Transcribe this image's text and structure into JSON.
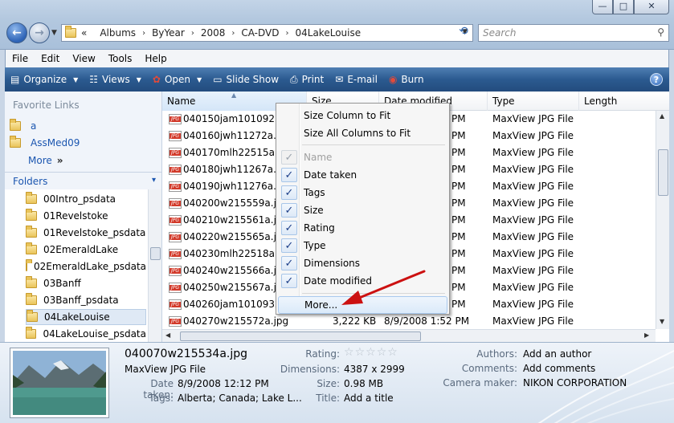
{
  "window": {
    "buttons": [
      "—",
      "□",
      "✕"
    ]
  },
  "address": {
    "overflow": "«",
    "crumbs": [
      "Albums",
      "ByYear",
      "2008",
      "CA-DVD",
      "04LakeLouise"
    ]
  },
  "search": {
    "placeholder": "Search"
  },
  "menubar": [
    "File",
    "Edit",
    "View",
    "Tools",
    "Help"
  ],
  "toolbar": {
    "organize": "Organize",
    "views": "Views",
    "open": "Open",
    "slideshow": "Slide Show",
    "print": "Print",
    "email": "E-mail",
    "burn": "Burn",
    "help": "?"
  },
  "nav": {
    "favorites_title": "Favorite Links",
    "favorites": [
      "a",
      "AssMed09"
    ],
    "more": "More",
    "more_glyph": "»",
    "folders_title": "Folders",
    "tree": [
      "00Intro_psdata",
      "01Revelstoke",
      "01Revelstoke_psdata",
      "02EmeraldLake",
      "02EmeraldLake_psdata",
      "03Banff",
      "03Banff_psdata",
      "04LakeLouise",
      "04LakeLouise_psdata"
    ],
    "selected_index": 7
  },
  "columns": {
    "name": "Name",
    "size": "Size",
    "date": "Date modified",
    "type": "Type",
    "length": "Length"
  },
  "files": [
    {
      "name": "040150jam1010925a",
      "time": "PM",
      "type": "MaxView JPG File"
    },
    {
      "name": "040160jwh11272a.jp",
      "time": "PM",
      "type": "MaxView JPG File"
    },
    {
      "name": "040170mlh22515a.jp",
      "time": "PM",
      "type": "MaxView JPG File"
    },
    {
      "name": "040180jwh11267a.jp",
      "time": "PM",
      "type": "MaxView JPG File"
    },
    {
      "name": "040190jwh11276a.jp",
      "time": "PM",
      "type": "MaxView JPG File"
    },
    {
      "name": "040200w215559a.jp",
      "time": "PM",
      "type": "MaxView JPG File"
    },
    {
      "name": "040210w215561a.jp",
      "time": "PM",
      "type": "MaxView JPG File"
    },
    {
      "name": "040220w215565a.jp",
      "time": "PM",
      "type": "MaxView JPG File"
    },
    {
      "name": "040230mlh22518a.jp",
      "time": "PM",
      "type": "MaxView JPG File"
    },
    {
      "name": "040240w215566a.jp",
      "time": "PM",
      "type": "MaxView JPG File"
    },
    {
      "name": "040250w215567a.jp",
      "time": "PM",
      "type": "MaxView JPG File"
    },
    {
      "name": "040260jam1010932a",
      "time": "PM",
      "type": "MaxView JPG File"
    },
    {
      "name": "040270w215572a.jpg",
      "size": "3,222 KB",
      "date": "8/9/2008 1:52 PM",
      "type": "MaxView JPG File"
    }
  ],
  "context_menu": {
    "size_col": "Size Column to Fit",
    "size_all": "Size All Columns to Fit",
    "items": [
      {
        "label": "Name",
        "checked": true,
        "disabled": true
      },
      {
        "label": "Date taken",
        "checked": true
      },
      {
        "label": "Tags",
        "checked": true
      },
      {
        "label": "Size",
        "checked": true
      },
      {
        "label": "Rating",
        "checked": true
      },
      {
        "label": "Type",
        "checked": true
      },
      {
        "label": "Dimensions",
        "checked": true
      },
      {
        "label": "Date modified",
        "checked": true
      }
    ],
    "more": "More...",
    "check_glyph": "✓"
  },
  "details": {
    "filename": "040070w215534a.jpg",
    "filetype": "MaxView JPG File",
    "date_taken_label": "Date taken:",
    "date_taken": "8/9/2008 12:12 PM",
    "tags_label": "Tags:",
    "tags": "Alberta; Canada; Lake L...",
    "rating_label": "Rating:",
    "rating_stars": 0,
    "dimensions_label": "Dimensions:",
    "dimensions": "4387 x 2999",
    "size_label": "Size:",
    "size": "0.98 MB",
    "title_label": "Title:",
    "title": "Add a title",
    "authors_label": "Authors:",
    "authors": "Add an author",
    "comments_label": "Comments:",
    "comments": "Add comments",
    "camera_label": "Camera maker:",
    "camera": "NIKON CORPORATION"
  },
  "colors": {
    "toolbar_top": "#4f7fb3",
    "toolbar_bottom": "#234c7e",
    "link_blue": "#1b56b0",
    "arrow_red": "#cc1111"
  }
}
